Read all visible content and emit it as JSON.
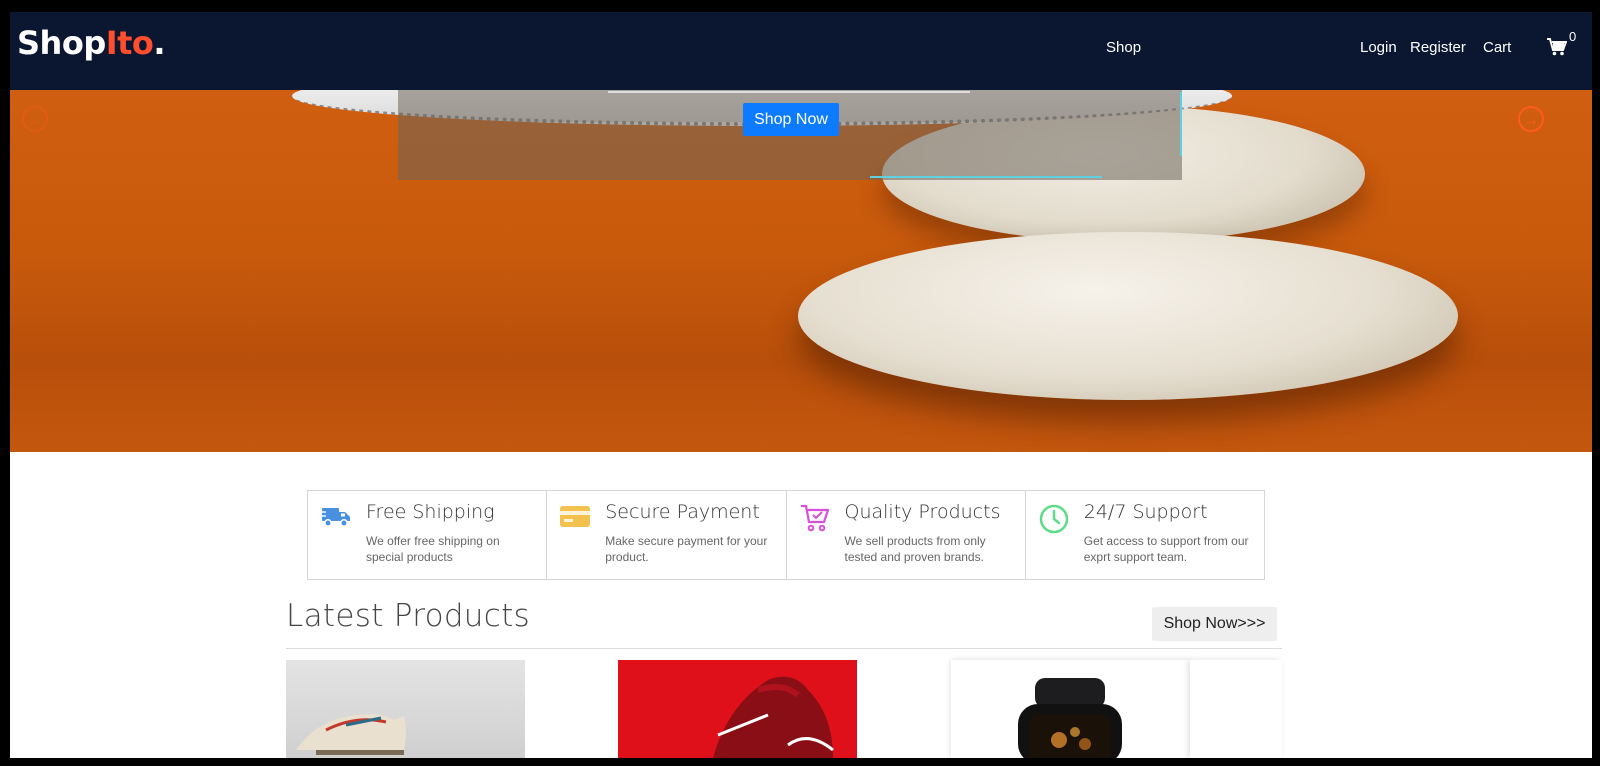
{
  "nav": {
    "logo_main": "Shop",
    "logo_accent": "Ito",
    "logo_dot": ".",
    "shop": "Shop",
    "login": "Login",
    "register": "Register",
    "cart": "Cart",
    "cart_count": "0"
  },
  "hero": {
    "button": "Shop Now"
  },
  "features": [
    {
      "title": "Free Shipping",
      "desc": "We offer free shipping on special products",
      "icon": "truck-icon",
      "color": "#4a90e2"
    },
    {
      "title": "Secure Payment",
      "desc": "Make secure payment for your product.",
      "icon": "credit-card-icon",
      "color": "#f2c14e"
    },
    {
      "title": "Quality Products",
      "desc": "We sell products from only tested and proven brands.",
      "icon": "shopping-cart-icon",
      "color": "#d94fd9"
    },
    {
      "title": "24/7 Support",
      "desc": "Get access to support from our exprt support team.",
      "icon": "clock-icon",
      "color": "#5fdc8a"
    }
  ],
  "latest": {
    "title": "Latest Products",
    "button": "Shop Now>>>"
  },
  "colors": {
    "nav_bg": "#0b1730",
    "accent": "#ff4d2e",
    "hero_button": "#0d7bff"
  }
}
